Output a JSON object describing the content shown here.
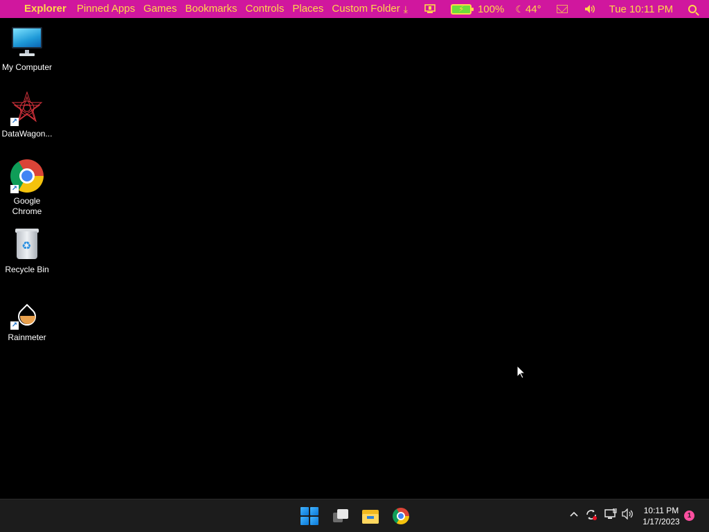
{
  "topbar": {
    "menu": [
      "Explorer",
      "Pinned Apps",
      "Games",
      "Bookmarks",
      "Controls",
      "Places",
      "Custom Folder"
    ],
    "battery": "100%",
    "weather": "44°",
    "clock": "Tue 10:11 PM",
    "accent_color": "#d0179e",
    "text_color": "#ffd84a"
  },
  "desktop_icons": [
    {
      "label": "My Computer",
      "icon": "monitor-icon"
    },
    {
      "label": "DataWagon...",
      "icon": "datawagon-icon"
    },
    {
      "label": "Google Chrome",
      "icon": "chrome-icon"
    },
    {
      "label": "Recycle Bin",
      "icon": "recycle-bin-icon"
    },
    {
      "label": "Rainmeter",
      "icon": "rainmeter-icon"
    }
  ],
  "taskbar": {
    "apps": [
      "start-icon",
      "task-view-icon",
      "file-explorer-icon",
      "chrome-icon"
    ],
    "time": "10:11 PM",
    "date": "1/17/2023",
    "notification_count": "1"
  }
}
